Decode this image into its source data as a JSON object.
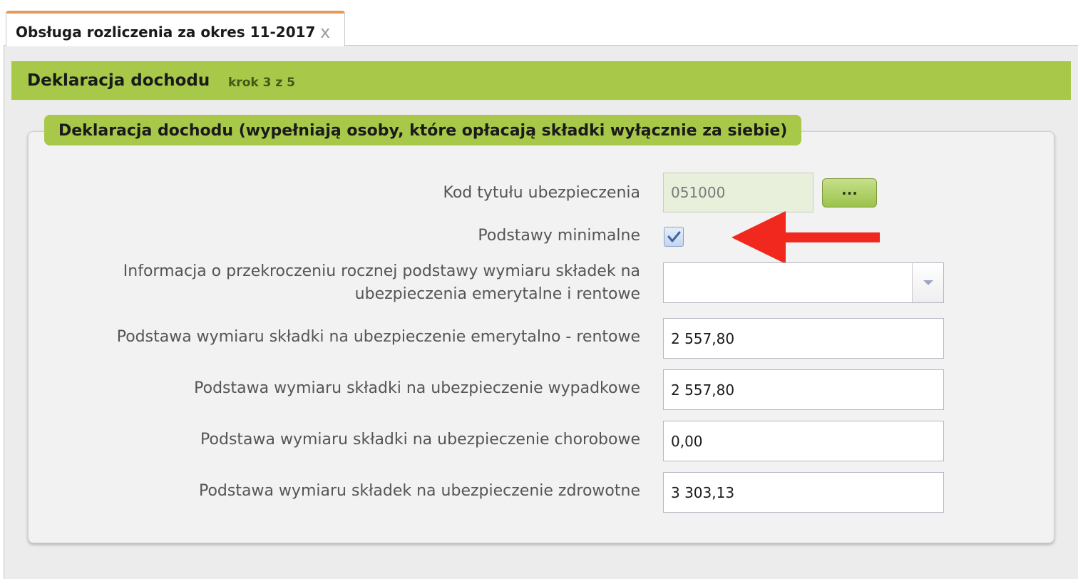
{
  "tab": {
    "title": "Obsługa rozliczenia za okres 11-2017",
    "close_label": "x"
  },
  "header": {
    "title": "Deklaracja dochodu",
    "step": "krok 3 z 5"
  },
  "panel": {
    "legend": "Deklaracja dochodu (wypełniają osoby, które opłacają składki wyłącznie za siebie)"
  },
  "form": {
    "kod_label": "Kod tytułu ubezpieczenia",
    "kod_value": "051000",
    "dots_label": "...",
    "minimalne_label": "Podstawy minimalne",
    "minimalne_checked": true,
    "info_label_line1": "Informacja o przekroczeniu rocznej podstawy wymiaru składek na",
    "info_label_line2": "ubezpieczenia emerytalne i rentowe",
    "info_value": "",
    "emerytalno_label": "Podstawa wymiaru składki na ubezpieczenie emerytalno - rentowe",
    "emerytalno_value": "2 557,80",
    "wypadkowe_label": "Podstawa wymiaru składki na ubezpieczenie wypadkowe",
    "wypadkowe_value": "2 557,80",
    "chorobowe_label": "Podstawa wymiaru składki na ubezpieczenie chorobowe",
    "chorobowe_value": "0,00",
    "zdrowotne_label": "Podstawa wymiaru składek na ubezpieczenie zdrowotne",
    "zdrowotne_value": "3 303,13"
  },
  "colors": {
    "accent_green": "#a8c84a",
    "tab_top_border": "#e49a5c",
    "annotation_red": "#f0281e"
  },
  "icons": {
    "close": "close-icon",
    "checkbox_mark": "checkmark-icon",
    "dropdown": "chevron-down-icon",
    "annotation": "arrow-left-icon"
  }
}
